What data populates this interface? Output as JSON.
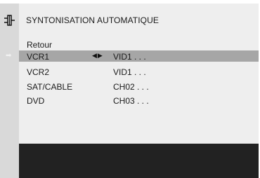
{
  "menu": {
    "title": "SYNTONISATION AUTOMATIQUE",
    "back_label": "Retour",
    "selected_index": 0,
    "rows": [
      {
        "label": "VCR1",
        "value": "VID1 . . ."
      },
      {
        "label": "VCR2",
        "value": "VID1 . . ."
      },
      {
        "label": "SAT/CABLE",
        "value": "CH02 . . ."
      },
      {
        "label": "DVD",
        "value": "CH03 . . ."
      }
    ]
  },
  "icons": {
    "menu_icon": "connector-icon",
    "pointer": "right-arrow-icon",
    "adjust": "left-right-arrows-icon"
  },
  "colors": {
    "highlight": "#a6a6a6",
    "panel": "#eeeeee",
    "sidebar": "#d9d9d9",
    "bottom": "#222222"
  }
}
